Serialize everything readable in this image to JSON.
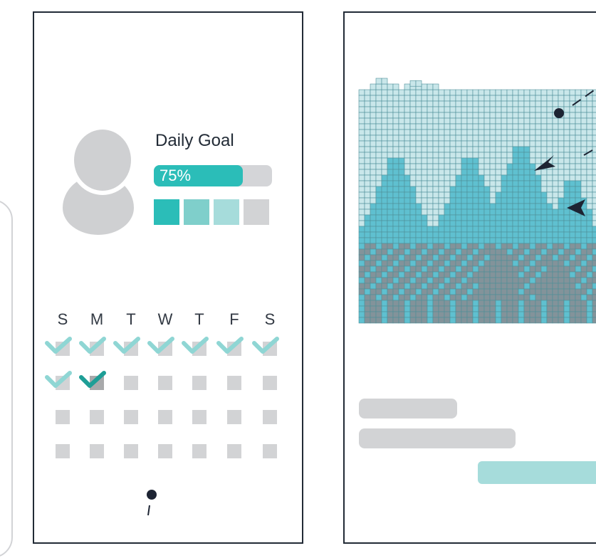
{
  "colors": {
    "accent": "#2bbdb8",
    "accent_mid": "#7fcfcb",
    "accent_light": "#a6dcdb",
    "placeholder": "#d2d3d5",
    "frame": "#222b36",
    "check_light": "#8fd6d4",
    "check_dark": "#1e9e96",
    "sky": "#c9e7ea",
    "tree_light": "#5fc0d0",
    "tree_dark": "#83939a"
  },
  "left_screen": {
    "goal": {
      "title": "Daily Goal",
      "progress": 0.75,
      "progress_label": "75%"
    },
    "swatches": [
      "#2bbdb8",
      "#7fcfcb",
      "#a6dcdb",
      "#d2d3d5"
    ],
    "calendar": {
      "weekdays": [
        "S",
        "M",
        "T",
        "W",
        "T",
        "F",
        "S"
      ],
      "completed_days": 8,
      "current_day_index": 8
    },
    "icons": {
      "avatar": "user-avatar-icon",
      "check": "checkmark-icon"
    }
  },
  "right_screen": {
    "illustration": "pixel-art-pine-forest",
    "icons": [
      "dot-marker-icon",
      "arrow-pointer-icon",
      "arrow-pointer-icon"
    ]
  }
}
